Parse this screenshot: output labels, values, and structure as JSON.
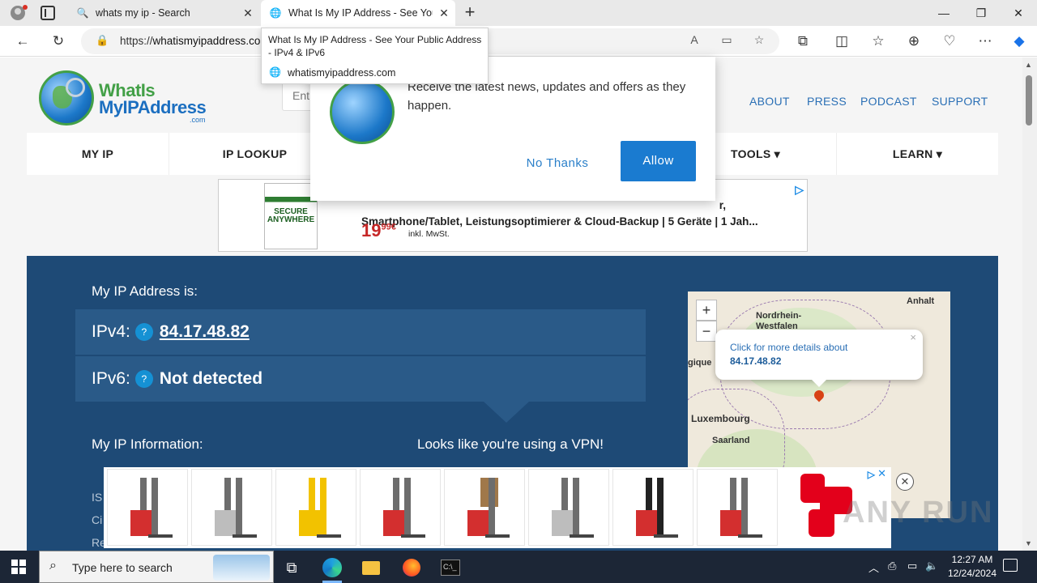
{
  "browser": {
    "tabs": [
      {
        "title": "whats my ip - Search",
        "icon": "search-icon"
      },
      {
        "title": "What Is My IP Address - See Your",
        "icon": "globe-icon"
      }
    ],
    "url_prefix": "https://",
    "url_host": "whatismyipaddress.co",
    "tooltip": {
      "title": "What Is My IP Address - See Your Public Address - IPv4 & IPv6",
      "domain": "whatismyipaddress.com"
    }
  },
  "site": {
    "logo": {
      "line1": "WhatIs",
      "line2": "MyIPAddress",
      "suffix": ".com"
    },
    "search_placeholder": "Ent",
    "topnav": [
      "ABOUT",
      "PRESS",
      "PODCAST",
      "SUPPORT"
    ],
    "mainnav": [
      "MY IP",
      "IP LOOKUP",
      "TOOLS ▾",
      "LEARN ▾"
    ]
  },
  "ad_top": {
    "product_text": "SECURE ANYWHERE",
    "line1": "r,",
    "line2": "Smartphone/Tablet, Leistungsoptimierer & Cloud-Backup | 5 Geräte | 1 Jah...",
    "price_main": "19",
    "price_cents": "99",
    "currency": "€",
    "tax": "inkl. MwSt."
  },
  "ip": {
    "heading": "My IP Address is:",
    "ipv4_label": "IPv4:",
    "ipv4_value": "84.17.48.82",
    "ipv6_label": "IPv6:",
    "ipv6_value": "Not detected",
    "help": "?",
    "info_heading": "My IP Information:",
    "vpn_message": "Looks like you're using a VPN!",
    "cut_labels": [
      "IS",
      "Ci",
      "Re"
    ]
  },
  "map": {
    "places": [
      "Nordrhein-\nWestfalen",
      "Anhalt",
      "gique",
      "Luxembourg",
      "Saarland"
    ],
    "popup_line1": "Click for more details about",
    "popup_ip": "84.17.48.82",
    "zoom_in": "+",
    "zoom_out": "−"
  },
  "notification": {
    "message": "Receive the latest news, updates and offers as they happen.",
    "no_label": "No Thanks",
    "allow_label": "Allow"
  },
  "taskbar": {
    "search_placeholder": "Type here to search",
    "time": "12:27 AM",
    "date": "12/24/2024"
  },
  "watermark": "ANY RUN"
}
